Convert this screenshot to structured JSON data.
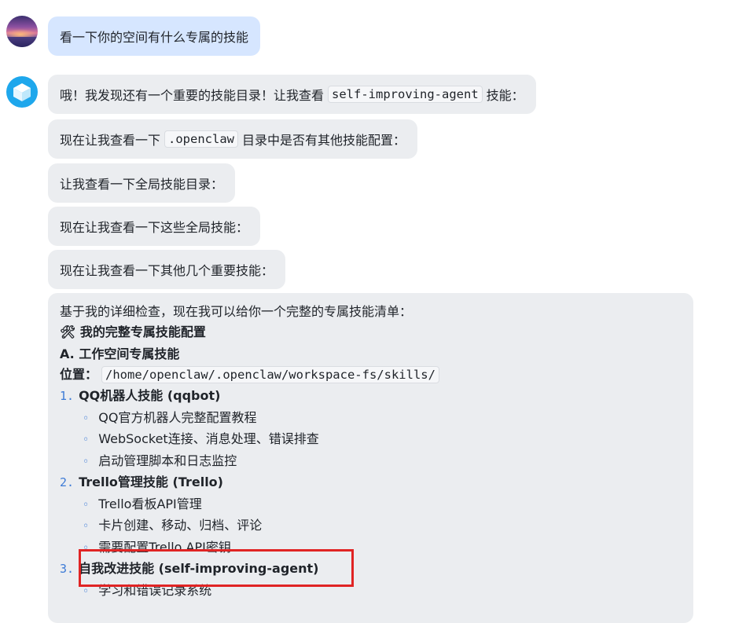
{
  "user_message": "看一下你的空间有什么专属的技能",
  "bot_messages": [
    {
      "pre": "哦！我发现还有一个重要的技能目录！让我查看",
      "code": "self-improving-agent",
      "post": "技能："
    },
    {
      "pre": "现在让我查看一下",
      "code": ".openclaw",
      "post": "目录中是否有其他技能配置："
    },
    {
      "text": "让我查看一下全局技能目录："
    },
    {
      "text": "现在让我查看一下这些全局技能："
    },
    {
      "text": "现在让我查看一下其他几个重要技能："
    }
  ],
  "summary": {
    "intro": "基于我的详细检查，现在我可以给你一个完整的专属技能清单：",
    "heading_icon": "🛠",
    "heading": "我的完整专属技能配置",
    "section_a": "A. 工作空间专属技能",
    "location_label": "位置：",
    "location_path": "/home/openclaw/.openclaw/workspace-fs/skills/",
    "skills": [
      {
        "num": "1.",
        "title": "QQ机器人技能 (qqbot)",
        "items": [
          "QQ官方机器人完整配置教程",
          "WebSocket连接、消息处理、错误排查",
          "启动管理脚本和日志监控"
        ]
      },
      {
        "num": "2.",
        "title": "Trello管理技能 (Trello)",
        "items": [
          "Trello看板API管理",
          "卡片创建、移动、归档、评论",
          "需要配置Trello API密钥"
        ]
      },
      {
        "num": "3.",
        "title": "自我改进技能 (self-improving-agent)",
        "items": [
          "学习和错误记录系统"
        ]
      }
    ],
    "bullet": "◦"
  },
  "colors": {
    "user_bubble": "#d6e6ff",
    "bot_bubble": "#ebedf0",
    "accent": "#3d7bd6",
    "highlight_box": "#e02424"
  }
}
